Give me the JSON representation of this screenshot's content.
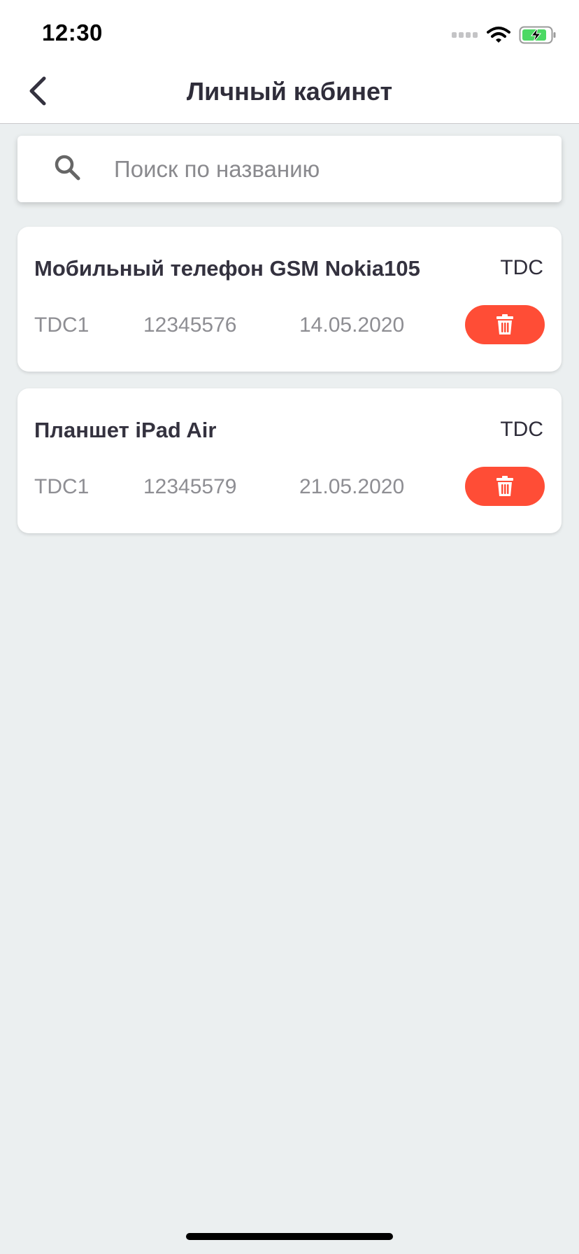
{
  "status_bar": {
    "time": "12:30"
  },
  "header": {
    "title": "Личный кабинет",
    "back_icon": "chevron-left-icon"
  },
  "search": {
    "placeholder": "Поиск по названию",
    "value": "",
    "icon": "search-icon"
  },
  "items": [
    {
      "title": "Мобильный телефон GSM Nokia105",
      "code": "TDC",
      "type": "TDC1",
      "number": "12345576",
      "date": "14.05.2020"
    },
    {
      "title": "Планшет iPad Air",
      "code": "TDC",
      "type": "TDC1",
      "number": "12345579",
      "date": "21.05.2020"
    }
  ],
  "colors": {
    "accent_delete": "#ff4d36",
    "background": "#ebeff0",
    "title_text": "#2f2d3a",
    "secondary_text": "#8e8e93",
    "battery_green": "#4cd964"
  }
}
